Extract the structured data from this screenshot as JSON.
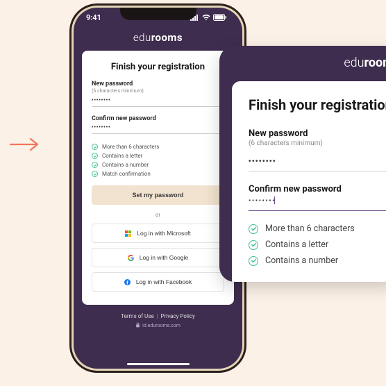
{
  "status": {
    "time": "9:41"
  },
  "brand": {
    "light": "edu",
    "bold": "rooms"
  },
  "card": {
    "title": "Finish your registration",
    "new_password": {
      "label": "New password",
      "hint": "(6 characters minimum)",
      "value": "••••••••"
    },
    "confirm_password": {
      "label": "Confirm new password",
      "value": "••••••••"
    },
    "checks": [
      "More than 6 characters",
      "Contains a letter",
      "Contains a number",
      "Match confirmation"
    ],
    "primary_button": "Set my password",
    "or": "or",
    "social": {
      "microsoft": "Log in with Microsoft",
      "google": "Log in with Google",
      "facebook": "Log in with Facebook"
    }
  },
  "footer": {
    "terms": "Terms of Use",
    "privacy": "Privacy Policy",
    "url": "id.edurooms.com"
  },
  "zoom": {
    "title": "Finish your registration",
    "new_password": {
      "label": "New password",
      "hint": "(6 characters minimum)",
      "value": "••••••••"
    },
    "confirm_password": {
      "label": "Confirm new password",
      "value": "••••••••"
    },
    "checks": [
      "More than 6 characters",
      "Contains a letter",
      "Contains a number"
    ]
  }
}
